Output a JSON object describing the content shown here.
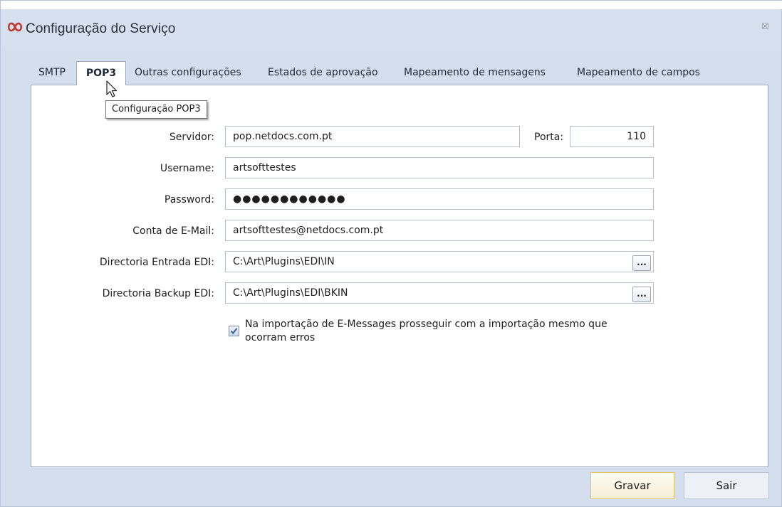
{
  "window": {
    "title": "Configuração do Serviço",
    "icon": "infinity-logo-icon",
    "close_glyph": "☒"
  },
  "tabs": [
    {
      "label": "SMTP",
      "active": false
    },
    {
      "label": "POP3",
      "active": true
    },
    {
      "label": "Outras configurações",
      "active": false
    },
    {
      "label": "Estados de aprovação",
      "active": false
    },
    {
      "label": "Mapeamento de mensagens",
      "active": false
    },
    {
      "label": "Mapeamento de campos",
      "active": false
    }
  ],
  "tooltip": "Configuração POP3",
  "form": {
    "server_label": "Servidor:",
    "server_value": "pop.netdocs.com.pt",
    "port_label": "Porta:",
    "port_value": "110",
    "username_label": "Username:",
    "username_value": "artsofttestes",
    "password_label": "Password:",
    "password_mask": "●●●●●●●●●●●●",
    "email_label": "Conta de E-Mail:",
    "email_value": "artsofttestes@netdocs.com.pt",
    "edi_in_label": "Directoria Entrada EDI:",
    "edi_in_value": "C:\\Art\\Plugins\\EDI\\IN",
    "edi_backup_label": "Directoria Backup EDI:",
    "edi_backup_value": "C:\\Art\\Plugins\\EDI\\BKIN",
    "browse_label": "...",
    "continue_on_error_checked": true,
    "continue_on_error_label_line1": "Na importação de E-Messages prosseguir com a importação mesmo que",
    "continue_on_error_label_line2": "ocorram erros"
  },
  "buttons": {
    "save": "Gravar",
    "exit": "Sair"
  },
  "colors": {
    "window_bg": "#d4deed",
    "panel_bg": "#ffffff",
    "save_border": "#e3c36a",
    "logo": "#c0392b"
  }
}
